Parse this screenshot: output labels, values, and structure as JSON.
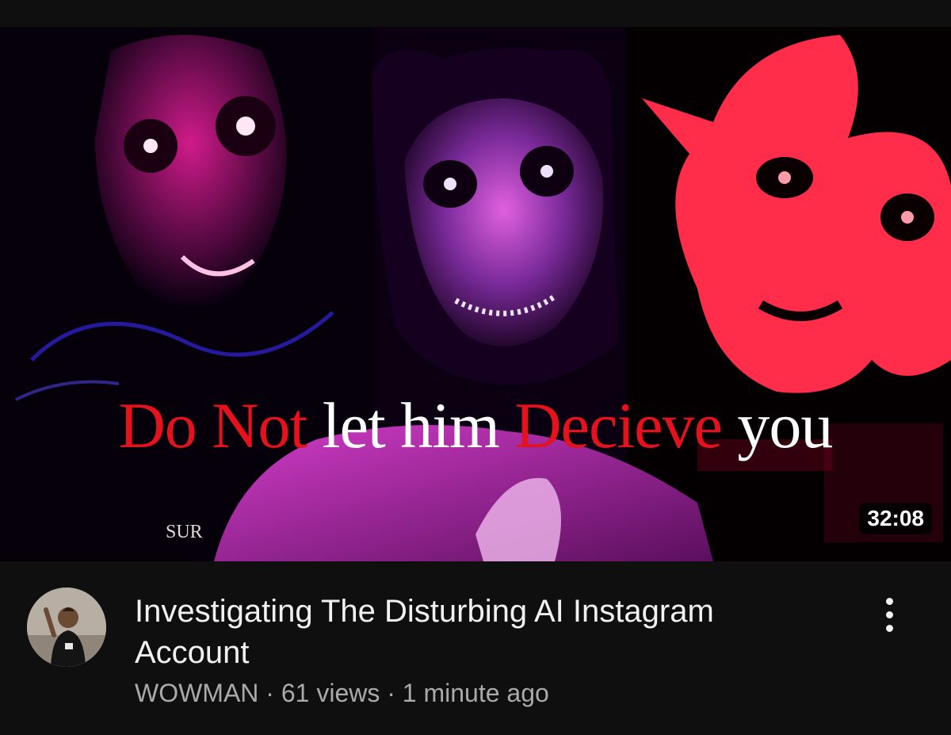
{
  "thumbnail": {
    "headline": {
      "part1": "Do Not",
      "part2": "let him",
      "part3": "Decieve",
      "part4": "you"
    },
    "watermark": "SUR",
    "duration": "32:08",
    "colors": {
      "accent_red": "#e3121c",
      "magenta": "#c21a8c",
      "crimson": "#ff2d4a"
    }
  },
  "video": {
    "title": "Investigating The Disturbing AI Instagram Account",
    "channel": "WOWMAN",
    "separator": "·",
    "views": "61 views",
    "uploaded": "1 minute ago"
  },
  "icons": {
    "more": "more-vertical-icon",
    "avatar": "channel-avatar"
  }
}
